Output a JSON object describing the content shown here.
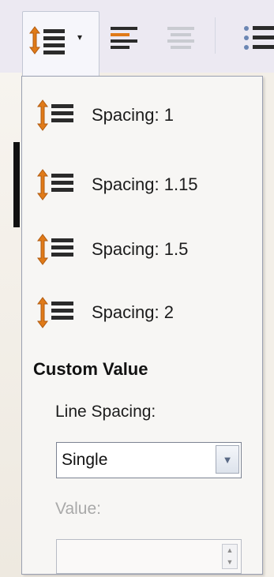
{
  "toolbar": {
    "buttons": [
      "line-spacing-dropdown",
      "align-left",
      "align-center",
      "bulleted-list"
    ]
  },
  "menu": {
    "items": [
      {
        "label": "Spacing: 1",
        "icon": "line-spacing-icon"
      },
      {
        "label": "Spacing: 1.15",
        "icon": "line-spacing-icon"
      },
      {
        "label": "Spacing: 1.5",
        "icon": "line-spacing-icon"
      },
      {
        "label": "Spacing: 2",
        "icon": "line-spacing-icon"
      }
    ],
    "section_title": "Custom Value",
    "line_spacing_label": "Line Spacing:",
    "line_spacing_value": "Single",
    "value_label": "Value:",
    "value_input": ""
  },
  "colors": {
    "icon_orange": "#e07a18",
    "icon_dark": "#2b2b2b",
    "icon_blue": "#6b86b3"
  }
}
